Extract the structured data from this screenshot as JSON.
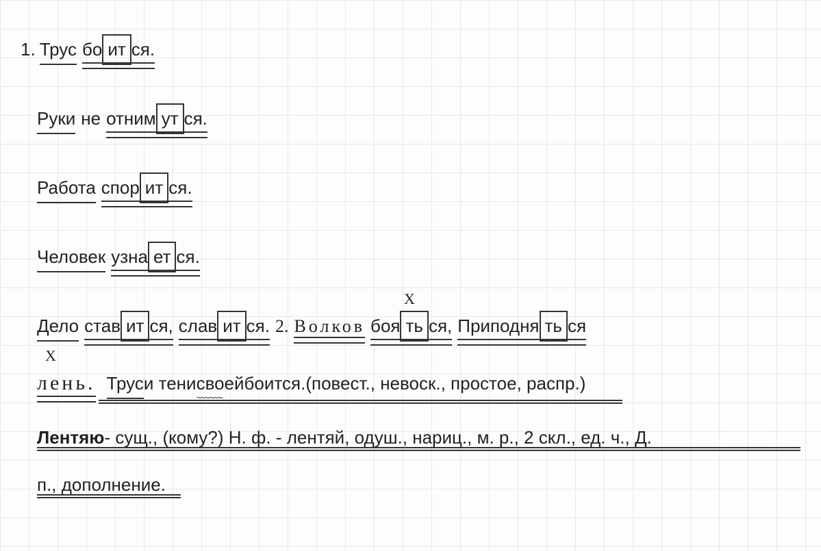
{
  "line1": {
    "num": "1.",
    "subject": "Трус",
    "pred_stem": "бо",
    "pred_box": "ит",
    "pred_suffix": "ся."
  },
  "line2": {
    "subject": "Руки",
    "neg": "не",
    "pred_stem": "отним",
    "pred_box": "ут",
    "pred_suffix": "ся."
  },
  "line3": {
    "subject": "Работа",
    "pred_stem": "спор",
    "pred_box": "ит",
    "pred_suffix": "ся."
  },
  "line4": {
    "subject": "Человек",
    "pred_stem": "узна",
    "pred_box": "ет",
    "pred_suffix": "ся."
  },
  "line5": {
    "x1": "X",
    "subject": "Дело",
    "pred1_stem": "став",
    "pred1_box": "ит",
    "pred1_suffix": "ся,",
    "pred2_stem": "слав",
    "pred2_box": "ит",
    "pred2_suffix": "ся.",
    "num2": "2.",
    "volkov": "Волков",
    "boya_stem": "боя",
    "boya_box": "ть",
    "boya_suffix": "ся,",
    "pripo_stem": "Приподня",
    "pripo_box": "ть",
    "pripo_suffix": "ся"
  },
  "line6": {
    "x2": "X",
    "len": "лень.",
    "sent_subj": "Трус",
    "sent_conj": " и тени ",
    "sent_svoej": "своей",
    "sent_pred": " боится. ",
    "sent_char": "(повест., невоск., простое, распр.)"
  },
  "line7": {
    "word": "Лентяю",
    "analysis": " - сущ., (кому?) Н. ф. - лентяй, одуш., нариц., м. р., 2 скл., ед. ч., Д."
  },
  "line8": {
    "tail": "п., дополнение."
  }
}
